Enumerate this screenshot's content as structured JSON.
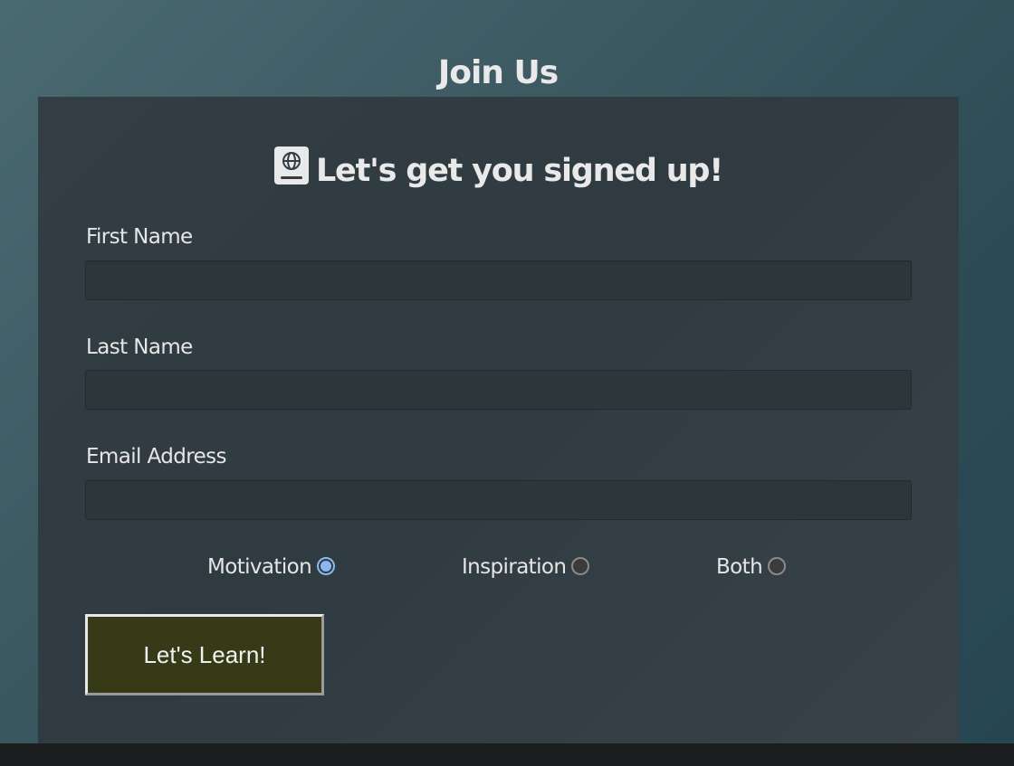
{
  "page": {
    "heading": "Join Us"
  },
  "form": {
    "title": "Let's get you signed up!",
    "title_icon": "passport-book-icon",
    "fields": [
      {
        "label": "First Name",
        "value": "",
        "placeholder": ""
      },
      {
        "label": "Last Name",
        "value": "",
        "placeholder": ""
      },
      {
        "label": "Email Address",
        "value": "",
        "placeholder": ""
      }
    ],
    "radio_options": [
      {
        "label": "Motivation",
        "checked": true
      },
      {
        "label": "Inspiration",
        "checked": false
      },
      {
        "label": "Both",
        "checked": false
      }
    ],
    "submit_label": "Let's Learn!"
  },
  "colors": {
    "button_bg": "#373a17",
    "radio_accent": "#8cb8f0"
  }
}
